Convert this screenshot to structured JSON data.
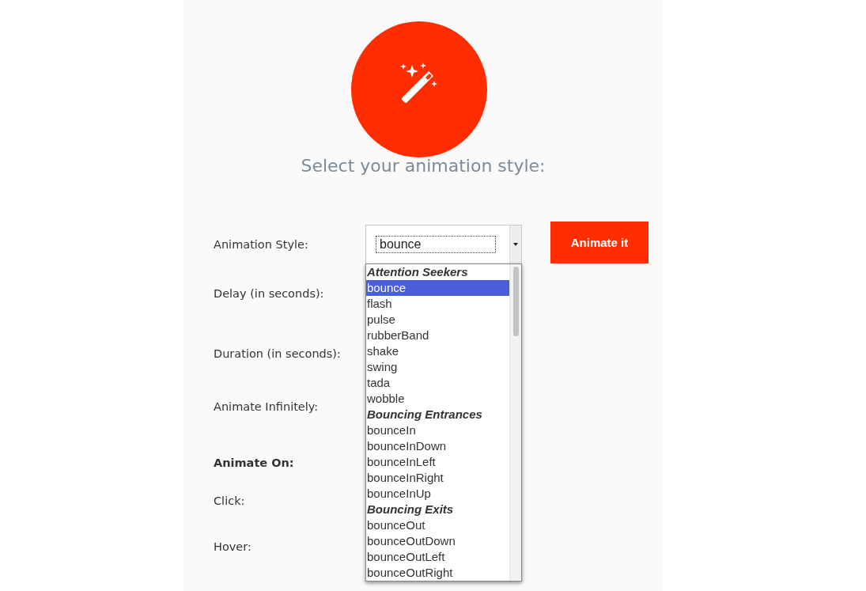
{
  "title": "Select your animation style:",
  "form": {
    "rows": [
      {
        "label": "Animation Style:",
        "kind": "select"
      },
      {
        "label": "Delay (in seconds):",
        "kind": "plain"
      },
      {
        "label": "Duration (in seconds):",
        "kind": "plain"
      },
      {
        "label": "Animate Infinitely:",
        "kind": "plain"
      },
      {
        "label": "Animate On:",
        "kind": "heading"
      },
      {
        "label": "Click:",
        "kind": "plain"
      },
      {
        "label": "Hover:",
        "kind": "plain"
      }
    ]
  },
  "select": {
    "value": "bounce",
    "expanded": true
  },
  "button": {
    "label": "Animate it"
  },
  "dropdown": {
    "items": [
      {
        "kind": "group",
        "label": "Attention Seekers"
      },
      {
        "kind": "option",
        "label": "bounce",
        "selected": true
      },
      {
        "kind": "option",
        "label": "flash",
        "selected": false
      },
      {
        "kind": "option",
        "label": "pulse",
        "selected": false
      },
      {
        "kind": "option",
        "label": "rubberBand",
        "selected": false
      },
      {
        "kind": "option",
        "label": "shake",
        "selected": false
      },
      {
        "kind": "option",
        "label": "swing",
        "selected": false
      },
      {
        "kind": "option",
        "label": "tada",
        "selected": false
      },
      {
        "kind": "option",
        "label": "wobble",
        "selected": false
      },
      {
        "kind": "group",
        "label": "Bouncing Entrances"
      },
      {
        "kind": "option",
        "label": "bounceIn",
        "selected": false
      },
      {
        "kind": "option",
        "label": "bounceInDown",
        "selected": false
      },
      {
        "kind": "option",
        "label": "bounceInLeft",
        "selected": false
      },
      {
        "kind": "option",
        "label": "bounceInRight",
        "selected": false
      },
      {
        "kind": "option",
        "label": "bounceInUp",
        "selected": false
      },
      {
        "kind": "group",
        "label": "Bouncing Exits"
      },
      {
        "kind": "option",
        "label": "bounceOut",
        "selected": false
      },
      {
        "kind": "option",
        "label": "bounceOutDown",
        "selected": false
      },
      {
        "kind": "option",
        "label": "bounceOutLeft",
        "selected": false
      },
      {
        "kind": "option",
        "label": "bounceOutRight",
        "selected": false
      }
    ]
  }
}
